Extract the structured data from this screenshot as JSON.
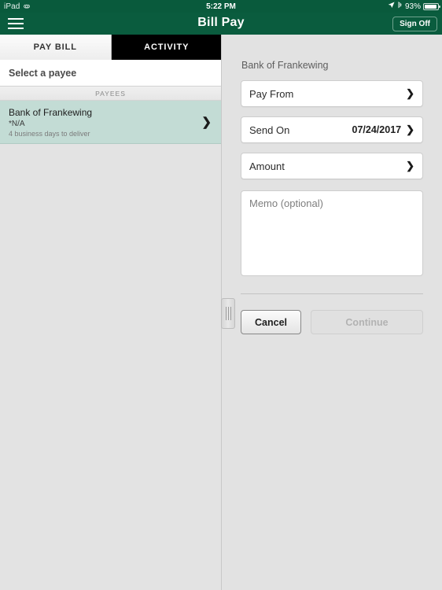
{
  "statusbar": {
    "device": "iPad",
    "link_icon": "link-icon",
    "time": "5:22 PM",
    "location_icon": "location-arrow-icon",
    "bluetooth_icon": "bluetooth-icon",
    "battery_percent": "93%",
    "battery_icon": "battery-icon"
  },
  "navbar": {
    "menu_icon": "hamburger-menu-icon",
    "title": "Bill Pay",
    "signoff_label": "Sign Off"
  },
  "tabs": [
    {
      "label": "PAY BILL",
      "selected": true
    },
    {
      "label": "ACTIVITY",
      "selected": false
    }
  ],
  "left": {
    "select_payee_label": "Select a payee",
    "payees_header": "PAYEES",
    "payees": [
      {
        "name": "Bank of Frankewing",
        "account": "*N/A",
        "delivery": "4 business days to deliver",
        "chevron": "chevron-right-icon"
      }
    ]
  },
  "splitter": {
    "handle_icon": "drag-handle-icon"
  },
  "form": {
    "heading": "Bank of Frankewing",
    "pay_from": {
      "label": "Pay From",
      "value": "",
      "chevron": "chevron-right-icon"
    },
    "send_on": {
      "label": "Send On",
      "value": "07/24/2017",
      "chevron": "chevron-right-icon"
    },
    "amount": {
      "label": "Amount",
      "value": "",
      "chevron": "chevron-right-icon"
    },
    "memo": {
      "placeholder": "Memo (optional)",
      "value": ""
    },
    "cancel_label": "Cancel",
    "continue_label": "Continue"
  },
  "colors": {
    "brand_green": "#0a5c3e",
    "status_green": "#095a3c",
    "payee_highlight": "#c3dcd5",
    "panel_gray": "#e2e2e2",
    "tab_active_bg": "#f4f4f4",
    "tab_inactive_bg": "#000000"
  }
}
